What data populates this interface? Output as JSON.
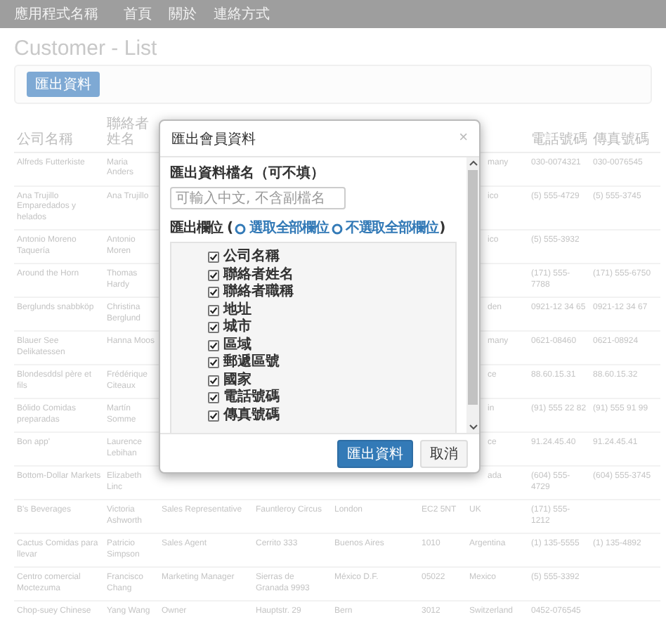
{
  "navbar": {
    "brand": "應用程式名稱",
    "links": [
      {
        "label": "首頁"
      },
      {
        "label": "關於"
      },
      {
        "label": "連絡方式"
      }
    ]
  },
  "page_title": "Customer - List",
  "toolbar": {
    "export_button": "匯出資料"
  },
  "table": {
    "columns": [
      "公司名稱",
      "聯絡者姓名",
      null,
      null,
      null,
      null,
      null,
      "電話號碼",
      "傳真號碼"
    ],
    "rows": [
      [
        "Alfreds Futterkiste",
        "Maria Anders",
        null,
        null,
        null,
        null,
        "many",
        "030-0074321",
        "030-0076545"
      ],
      [
        "Ana Trujillo Emparedados y helados",
        "Ana Trujillo",
        null,
        null,
        null,
        null,
        "ico",
        "(5) 555-4729",
        "(5) 555-3745"
      ],
      [
        "Antonio Moreno Taquería",
        "Antonio Moren",
        null,
        null,
        null,
        null,
        "ico",
        "(5) 555-3932",
        null
      ],
      [
        "Around the Horn",
        "Thomas Hardy",
        null,
        null,
        null,
        null,
        null,
        "(171) 555-7788",
        "(171) 555-6750"
      ],
      [
        "Berglunds snabbköp",
        "Christina Berglund",
        null,
        null,
        null,
        null,
        "den",
        "0921-12 34 65",
        "0921-12 34 67"
      ],
      [
        "Blauer See Delikatessen",
        "Hanna Moos",
        null,
        null,
        null,
        null,
        "many",
        "0621-08460",
        "0621-08924"
      ],
      [
        "Blondesddsl père et fils",
        "Frédérique Citeaux",
        null,
        null,
        null,
        null,
        "ce",
        "88.60.15.31",
        "88.60.15.32"
      ],
      [
        "Bólido Comidas preparadas",
        "Martín Somme",
        null,
        null,
        null,
        null,
        "in",
        "(91) 555 22 82",
        "(91) 555 91 99"
      ],
      [
        "Bon app'",
        "Laurence Lebihan",
        null,
        null,
        null,
        null,
        "ce",
        "91.24.45.40",
        "91.24.45.41"
      ],
      [
        "Bottom-Dollar Markets",
        "Elizabeth Linc",
        null,
        null,
        null,
        null,
        "ada",
        "(604) 555-4729",
        "(604) 555-3745"
      ],
      [
        "B's Beverages",
        "Victoria Ashworth",
        "Sales Representative",
        "Fauntleroy Circus",
        "London",
        "EC2 5NT",
        "UK",
        "(171) 555-1212",
        null
      ],
      [
        "Cactus Comidas para llevar",
        "Patricio Simpson",
        "Sales Agent",
        "Cerrito 333",
        "Buenos Aires",
        "1010",
        "Argentina",
        "(1) 135-5555",
        "(1) 135-4892"
      ],
      [
        "Centro comercial Moctezuma",
        "Francisco Chang",
        "Marketing Manager",
        "Sierras de Granada 9993",
        "México D.F.",
        "05022",
        "Mexico",
        "(5) 555-3392",
        null
      ],
      [
        "Chop-suey Chinese",
        "Yang Wang",
        "Owner",
        "Hauptstr. 29",
        "Bern",
        "3012",
        "Switzerland",
        "0452-076545",
        null
      ]
    ]
  },
  "modal": {
    "title": "匯出會員資料",
    "close": "×",
    "filename_label": "匯出資料檔名（可不填）",
    "filename_placeholder": "可輸入中文, 不含副檔名",
    "fields_label": "匯出欄位 (",
    "select_links": [
      "選取全部欄位",
      "不選取全部欄位"
    ],
    "fields_label_end": ")",
    "fields": [
      {
        "label": "公司名稱",
        "checked": true
      },
      {
        "label": "聯絡者姓名",
        "checked": true
      },
      {
        "label": "聯絡者職稱",
        "checked": true
      },
      {
        "label": "地址",
        "checked": true
      },
      {
        "label": "城市",
        "checked": true
      },
      {
        "label": "區域",
        "checked": true
      },
      {
        "label": "郵遞區號",
        "checked": true
      },
      {
        "label": "國家",
        "checked": true
      },
      {
        "label": "電話號碼",
        "checked": true
      },
      {
        "label": "傳真號碼",
        "checked": true
      }
    ],
    "buttons": [
      {
        "label": "匯出資料",
        "kind": "primary"
      },
      {
        "label": "取消",
        "kind": "default"
      }
    ]
  }
}
